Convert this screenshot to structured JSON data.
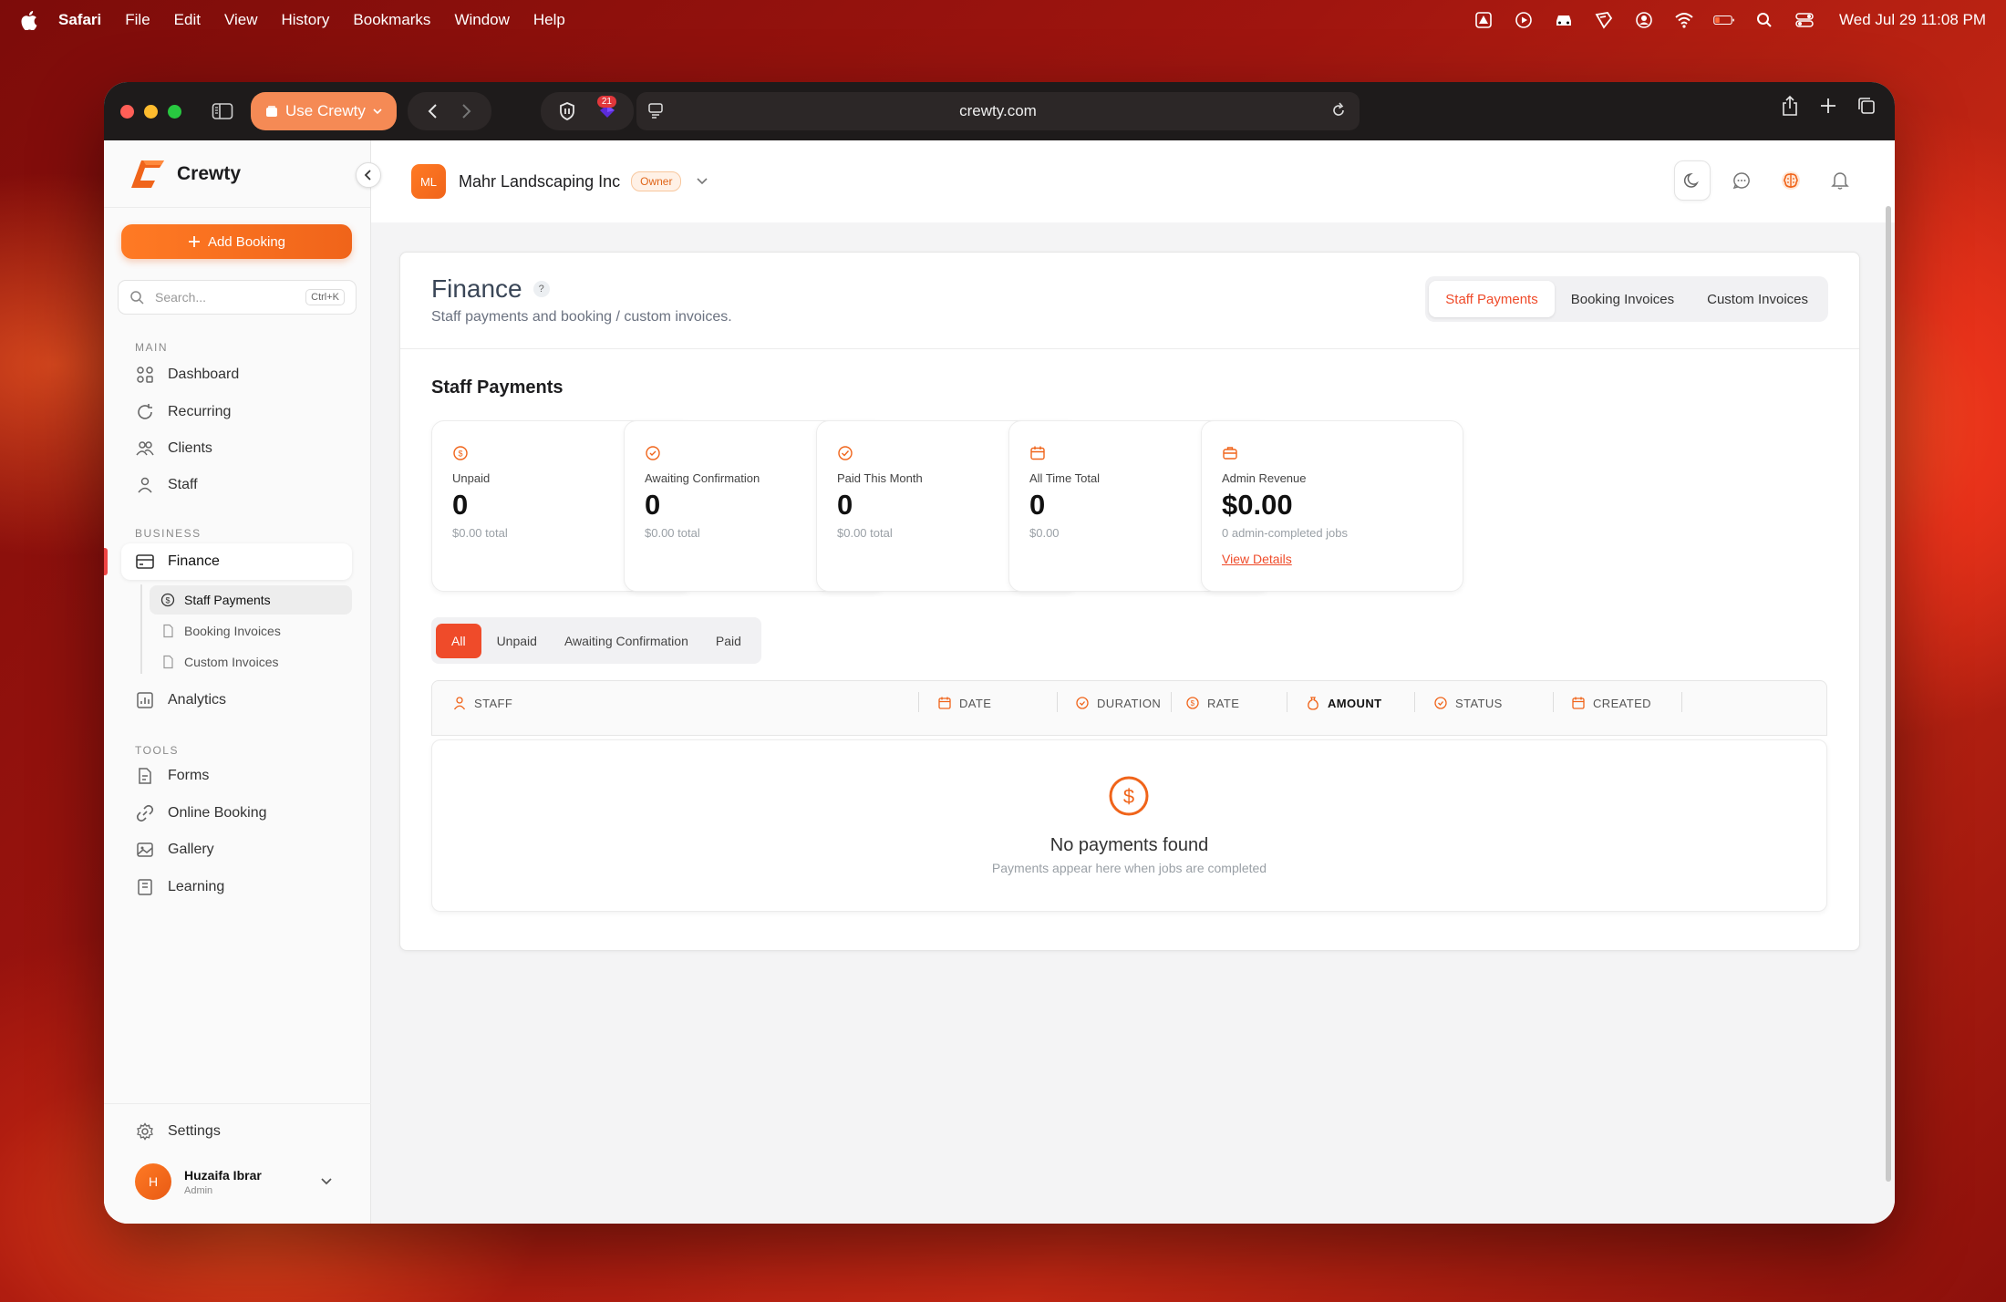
{
  "menubar": {
    "app": "Safari",
    "items": [
      "File",
      "Edit",
      "View",
      "History",
      "Bookmarks",
      "Window",
      "Help"
    ],
    "clock": "Wed Jul 29  11:08 PM"
  },
  "browser": {
    "tab_group": "Use Crewty",
    "extension_badge": "21",
    "url": "crewty.com"
  },
  "sidebar": {
    "brand": "Crewty",
    "add_booking": "Add Booking",
    "search_placeholder": "Search...",
    "search_shortcut": "Ctrl+K",
    "main_label": "MAIN",
    "main_items": [
      "Dashboard",
      "Recurring",
      "Clients",
      "Staff"
    ],
    "business_label": "BUSINESS",
    "finance": "Finance",
    "finance_sub": [
      "Staff Payments",
      "Booking Invoices",
      "Custom Invoices"
    ],
    "analytics": "Analytics",
    "tools_label": "TOOLS",
    "tools_items": [
      "Forms",
      "Online Booking",
      "Gallery",
      "Learning"
    ],
    "settings": "Settings",
    "user": {
      "initial": "H",
      "name": "Huzaifa Ibrar",
      "role": "Admin"
    }
  },
  "topbar": {
    "org_initials": "ML",
    "org_name": "Mahr Landscaping Inc",
    "role_badge": "Owner"
  },
  "page": {
    "title": "Finance",
    "help": "?",
    "subtitle": "Staff payments and booking / custom invoices.",
    "tabs": [
      "Staff Payments",
      "Booking Invoices",
      "Custom Invoices"
    ],
    "active_tab": "Staff Payments",
    "section_title": "Staff Payments",
    "cards": [
      {
        "label": "Unpaid",
        "value": "0",
        "sub": "$0.00 total",
        "icon": "dollar-circle-icon"
      },
      {
        "label": "Awaiting Confirmation",
        "value": "0",
        "sub": "$0.00 total",
        "icon": "clock-check-icon"
      },
      {
        "label": "Paid This Month",
        "value": "0",
        "sub": "$0.00 total",
        "icon": "check-circle-icon"
      },
      {
        "label": "All Time Total",
        "value": "0",
        "sub": "$0.00",
        "icon": "calendar-icon"
      },
      {
        "label": "Admin Revenue",
        "value": "$0.00",
        "sub": "0 admin-completed jobs",
        "link": "View Details",
        "icon": "briefcase-icon"
      }
    ],
    "filters": [
      "All",
      "Unpaid",
      "Awaiting Confirmation",
      "Paid"
    ],
    "active_filter": "All",
    "columns": [
      "STAFF",
      "DATE",
      "DURATION",
      "RATE",
      "AMOUNT",
      "STATUS",
      "CREATED"
    ],
    "empty_title": "No payments found",
    "empty_sub": "Payments appear here when jobs are completed"
  },
  "colors": {
    "accent": "#ef4b2a",
    "brand_orange": "#f0641a"
  }
}
